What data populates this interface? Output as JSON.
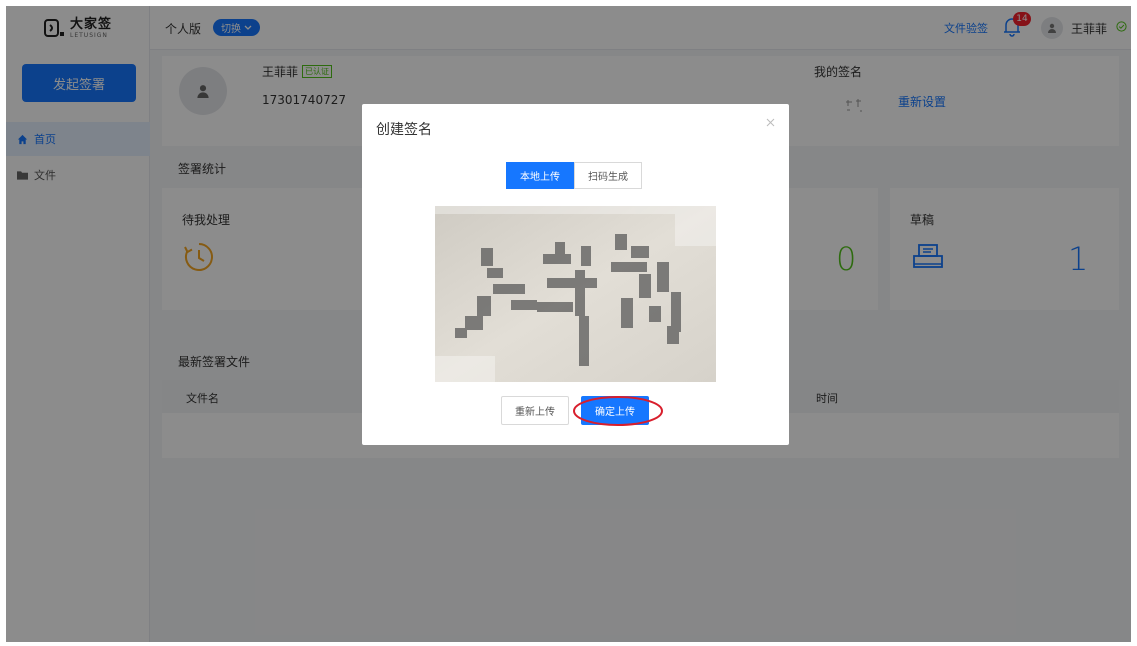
{
  "app": {
    "logo_name": "大家签",
    "logo_sub": "LETUSIGN"
  },
  "sidebar": {
    "start_sign_label": "发起签署",
    "items": [
      {
        "label": "首页",
        "icon": "home-icon",
        "active": true
      },
      {
        "label": "文件",
        "icon": "folder-icon",
        "active": false
      }
    ]
  },
  "header": {
    "edition_label": "个人版",
    "switch_label": "切换",
    "verify_label": "文件验签",
    "notification_count": "14",
    "user_name": "王菲菲"
  },
  "profile": {
    "name": "王菲菲",
    "cert_tag": "已认证",
    "phone": "17301740727",
    "my_signature_title": "我的签名",
    "reset_label": "重新设置"
  },
  "stats": {
    "section_title": "签署统计",
    "cards": [
      {
        "label": "待我处理",
        "value": "",
        "icon": "clock-icon"
      },
      {
        "label": "",
        "value": "0",
        "icon": ""
      },
      {
        "label": "草稿",
        "value": "1",
        "icon": "printer-icon"
      }
    ]
  },
  "recent": {
    "section_title": "最新签署文件",
    "columns": [
      "文件名",
      "时间"
    ]
  },
  "modal": {
    "title": "创建签名",
    "tabs": [
      "本地上传",
      "扫码生成"
    ],
    "active_tab": "本地上传",
    "reupload_label": "重新上传",
    "confirm_label": "确定上传"
  },
  "colors": {
    "primary": "#1677ff",
    "badge_red": "#f5222d",
    "success_green": "#52c41a",
    "clock_orange": "#f5a623",
    "annotation_red": "#d81e2c"
  }
}
